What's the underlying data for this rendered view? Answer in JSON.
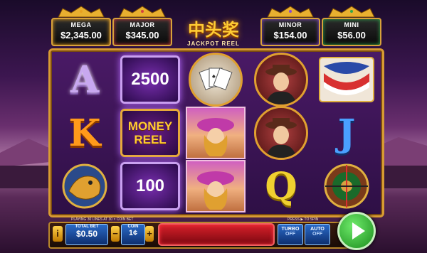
{
  "jackpots": [
    {
      "label": "MEGA",
      "value": "$2,345.00",
      "color": "#e8a020"
    },
    {
      "label": "MAJOR",
      "value": "$345.00",
      "color": "#d44040"
    },
    {
      "label": "MINOR",
      "value": "$154.00",
      "color": "#8a4ad0"
    },
    {
      "label": "MINI",
      "value": "$56.00",
      "color": "#2fa84a"
    }
  ],
  "logo": {
    "title": "中头奖",
    "subtitle": "JACKPOT REEL"
  },
  "reels": {
    "r1": {
      "top": "A",
      "mid": "K",
      "bot_icon": "golden-dragon-icon"
    },
    "r2": {
      "top": "2500",
      "mid_line1": "MONEY",
      "mid_line2": "REEL",
      "bot": "100"
    },
    "r3": {
      "top_icon": "playing-cards-icon",
      "mid_icon": "lady-icon",
      "bot_icon": "lady-icon"
    },
    "r4": {
      "top_icon": "gangster-icon",
      "mid_icon": "gangster-icon",
      "bot": "Q"
    },
    "r5": {
      "top_icon": "flag-bunting-icon",
      "mid": "J",
      "bot_icon": "roulette-wheel-icon"
    }
  },
  "controls": {
    "info": "i",
    "paying_text": "PLAYING 30 LINES AT 30 × COIN BET",
    "total_bet_label": "TOTAL BET",
    "total_bet_value": "$0.50",
    "minus": "−",
    "plus": "+",
    "coin_label": "COIN",
    "coin_value": "1¢",
    "press_text": "PRESS ▶ TO SPIN",
    "turbo_label": "TURBO",
    "turbo_state": "OFF",
    "auto_label": "AUTO",
    "auto_state": "OFF"
  }
}
